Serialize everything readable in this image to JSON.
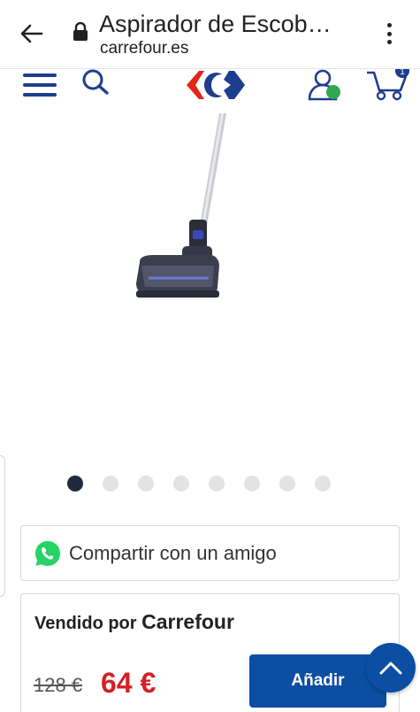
{
  "browser": {
    "title": "Aspirador de Escob…",
    "url": "carrefour.es"
  },
  "header": {
    "cart_count": "1"
  },
  "gallery": {
    "dot_count": 8,
    "active_index": 0
  },
  "share": {
    "label": "Compartir con un amigo"
  },
  "seller": {
    "sold_by_label": "Vendido por",
    "seller_name": "Carrefour"
  },
  "price": {
    "old": "128 €",
    "current": "64 €"
  },
  "actions": {
    "add_label": "Añadir"
  },
  "colors": {
    "brand_blue": "#0b4ea2",
    "price_red": "#d32027",
    "account_dot": "#2fa84f"
  }
}
